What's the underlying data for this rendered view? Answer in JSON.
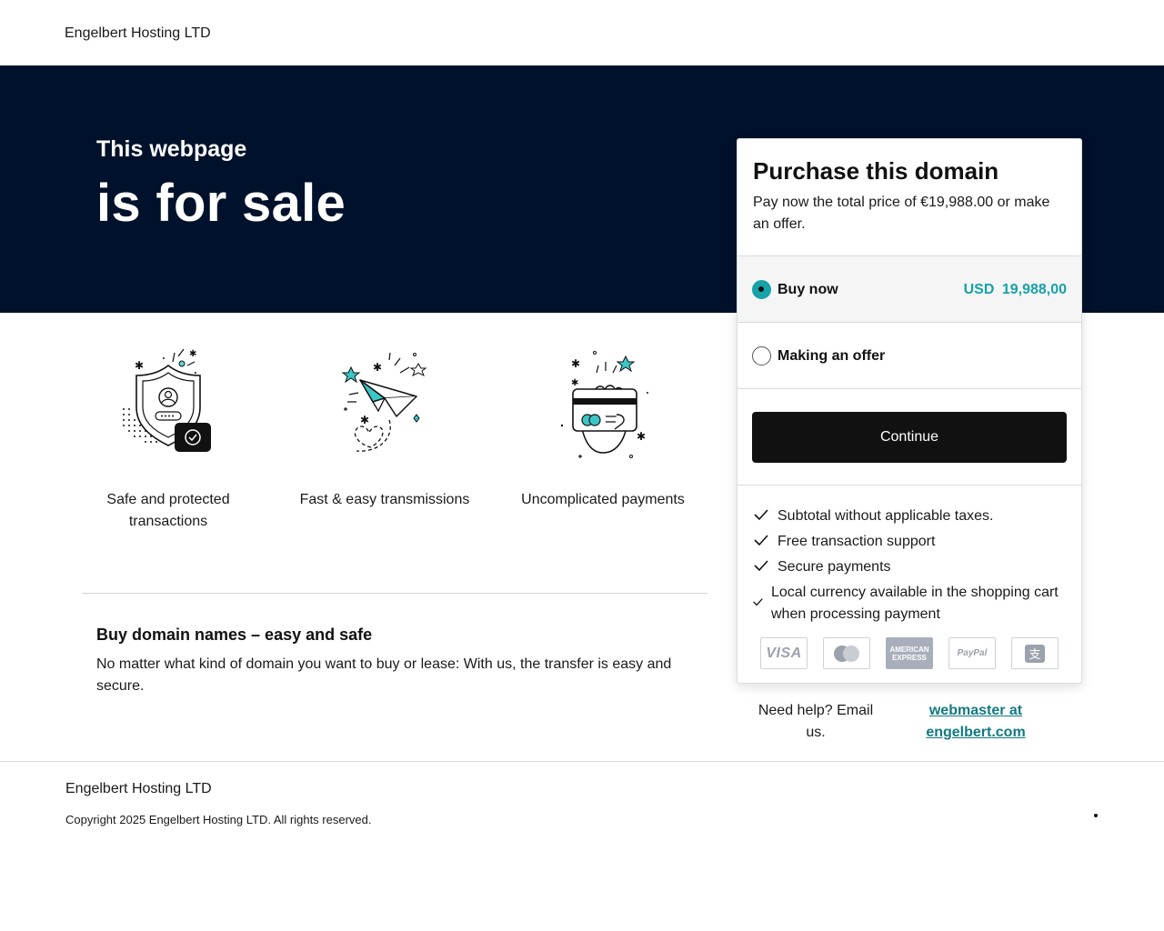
{
  "header": {
    "brand": "Engelbert Hosting LTD"
  },
  "hero": {
    "subtitle": "This webpage",
    "title": "is for sale"
  },
  "features": [
    {
      "icon": "shield-icon",
      "label": "Safe and protected transactions"
    },
    {
      "icon": "paper-plane-icon",
      "label": "Fast & easy transmissions"
    },
    {
      "icon": "credit-card-hand-icon",
      "label": "Uncomplicated payments"
    }
  ],
  "info": {
    "title": "Buy domain names – easy and safe",
    "text": "No matter what kind of domain you want to buy or lease: With us, the transfer is easy and secure."
  },
  "card": {
    "title": "Purchase this domain",
    "description": "Pay now the total price of €19,988.00 or make an offer.",
    "options": [
      {
        "label": "Buy now",
        "price": "USD 19,988,00",
        "selected": true
      },
      {
        "label": "Making an offer",
        "selected": false
      }
    ],
    "continue_label": "Continue",
    "benefits": [
      "Subtotal without applicable taxes.",
      "Free transaction support",
      "Secure payments",
      "Local currency available in the shopping cart when processing payment"
    ],
    "payment_methods": [
      "VISA",
      "Mastercard",
      "AMERICAN EXPRESS",
      "PayPal",
      "Alipay"
    ]
  },
  "help": {
    "text": "Need help? Email us.",
    "link": "webmaster at engelbert.com"
  },
  "footer": {
    "brand": "Engelbert Hosting LTD",
    "copyright": "Copyright 2025 Engelbert Hosting LTD. All rights reserved."
  },
  "colors": {
    "hero_bg": "#00112b",
    "accent": "#17a2a8",
    "link": "#117a80",
    "button_bg": "#111111"
  }
}
